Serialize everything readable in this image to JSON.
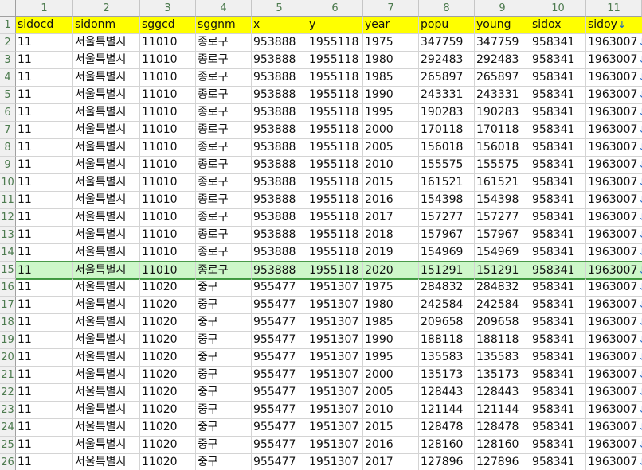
{
  "column_numbers": [
    "1",
    "2",
    "3",
    "4",
    "5",
    "6",
    "7",
    "8",
    "9",
    "10",
    "11"
  ],
  "headers": [
    "sidocd",
    "sidonm",
    "sggcd",
    "sggnm",
    "x",
    "y",
    "year",
    "popu",
    "young",
    "sidox",
    "sidoy"
  ],
  "truncation_arrow": "↓",
  "selected_row_index": 15,
  "rows": [
    {
      "n": "2",
      "v": [
        "11",
        "서울특별시",
        "11010",
        "종로구",
        "953888",
        "1955118",
        "1975",
        "347759",
        "347759",
        "958341",
        "1963007"
      ]
    },
    {
      "n": "3",
      "v": [
        "11",
        "서울특별시",
        "11010",
        "종로구",
        "953888",
        "1955118",
        "1980",
        "292483",
        "292483",
        "958341",
        "1963007"
      ]
    },
    {
      "n": "4",
      "v": [
        "11",
        "서울특별시",
        "11010",
        "종로구",
        "953888",
        "1955118",
        "1985",
        "265897",
        "265897",
        "958341",
        "1963007"
      ]
    },
    {
      "n": "5",
      "v": [
        "11",
        "서울특별시",
        "11010",
        "종로구",
        "953888",
        "1955118",
        "1990",
        "243331",
        "243331",
        "958341",
        "1963007"
      ]
    },
    {
      "n": "6",
      "v": [
        "11",
        "서울특별시",
        "11010",
        "종로구",
        "953888",
        "1955118",
        "1995",
        "190283",
        "190283",
        "958341",
        "1963007"
      ]
    },
    {
      "n": "7",
      "v": [
        "11",
        "서울특별시",
        "11010",
        "종로구",
        "953888",
        "1955118",
        "2000",
        "170118",
        "170118",
        "958341",
        "1963007"
      ]
    },
    {
      "n": "8",
      "v": [
        "11",
        "서울특별시",
        "11010",
        "종로구",
        "953888",
        "1955118",
        "2005",
        "156018",
        "156018",
        "958341",
        "1963007"
      ]
    },
    {
      "n": "9",
      "v": [
        "11",
        "서울특별시",
        "11010",
        "종로구",
        "953888",
        "1955118",
        "2010",
        "155575",
        "155575",
        "958341",
        "1963007"
      ]
    },
    {
      "n": "10",
      "v": [
        "11",
        "서울특별시",
        "11010",
        "종로구",
        "953888",
        "1955118",
        "2015",
        "161521",
        "161521",
        "958341",
        "1963007"
      ]
    },
    {
      "n": "11",
      "v": [
        "11",
        "서울특별시",
        "11010",
        "종로구",
        "953888",
        "1955118",
        "2016",
        "154398",
        "154398",
        "958341",
        "1963007"
      ]
    },
    {
      "n": "12",
      "v": [
        "11",
        "서울특별시",
        "11010",
        "종로구",
        "953888",
        "1955118",
        "2017",
        "157277",
        "157277",
        "958341",
        "1963007"
      ]
    },
    {
      "n": "13",
      "v": [
        "11",
        "서울특별시",
        "11010",
        "종로구",
        "953888",
        "1955118",
        "2018",
        "157967",
        "157967",
        "958341",
        "1963007"
      ]
    },
    {
      "n": "14",
      "v": [
        "11",
        "서울특별시",
        "11010",
        "종로구",
        "953888",
        "1955118",
        "2019",
        "154969",
        "154969",
        "958341",
        "1963007"
      ]
    },
    {
      "n": "15",
      "v": [
        "11",
        "서울특별시",
        "11010",
        "종로구",
        "953888",
        "1955118",
        "2020",
        "151291",
        "151291",
        "958341",
        "1963007"
      ]
    },
    {
      "n": "16",
      "v": [
        "11",
        "서울특별시",
        "11020",
        "중구",
        "955477",
        "1951307",
        "1975",
        "284832",
        "284832",
        "958341",
        "1963007"
      ]
    },
    {
      "n": "17",
      "v": [
        "11",
        "서울특별시",
        "11020",
        "중구",
        "955477",
        "1951307",
        "1980",
        "242584",
        "242584",
        "958341",
        "1963007"
      ]
    },
    {
      "n": "18",
      "v": [
        "11",
        "서울특별시",
        "11020",
        "중구",
        "955477",
        "1951307",
        "1985",
        "209658",
        "209658",
        "958341",
        "1963007"
      ]
    },
    {
      "n": "19",
      "v": [
        "11",
        "서울특별시",
        "11020",
        "중구",
        "955477",
        "1951307",
        "1990",
        "188118",
        "188118",
        "958341",
        "1963007"
      ]
    },
    {
      "n": "20",
      "v": [
        "11",
        "서울특별시",
        "11020",
        "중구",
        "955477",
        "1951307",
        "1995",
        "135583",
        "135583",
        "958341",
        "1963007"
      ]
    },
    {
      "n": "21",
      "v": [
        "11",
        "서울특별시",
        "11020",
        "중구",
        "955477",
        "1951307",
        "2000",
        "135173",
        "135173",
        "958341",
        "1963007"
      ]
    },
    {
      "n": "22",
      "v": [
        "11",
        "서울특별시",
        "11020",
        "중구",
        "955477",
        "1951307",
        "2005",
        "128443",
        "128443",
        "958341",
        "1963007"
      ]
    },
    {
      "n": "23",
      "v": [
        "11",
        "서울특별시",
        "11020",
        "중구",
        "955477",
        "1951307",
        "2010",
        "121144",
        "121144",
        "958341",
        "1963007"
      ]
    },
    {
      "n": "24",
      "v": [
        "11",
        "서울특별시",
        "11020",
        "중구",
        "955477",
        "1951307",
        "2015",
        "128478",
        "128478",
        "958341",
        "1963007"
      ]
    },
    {
      "n": "25",
      "v": [
        "11",
        "서울특별시",
        "11020",
        "중구",
        "955477",
        "1951307",
        "2016",
        "128160",
        "128160",
        "958341",
        "1963007"
      ]
    },
    {
      "n": "26",
      "v": [
        "11",
        "서울특별시",
        "11020",
        "중구",
        "955477",
        "1951307",
        "2017",
        "127896",
        "127896",
        "958341",
        "1963007"
      ]
    }
  ],
  "header_row_number": "1"
}
